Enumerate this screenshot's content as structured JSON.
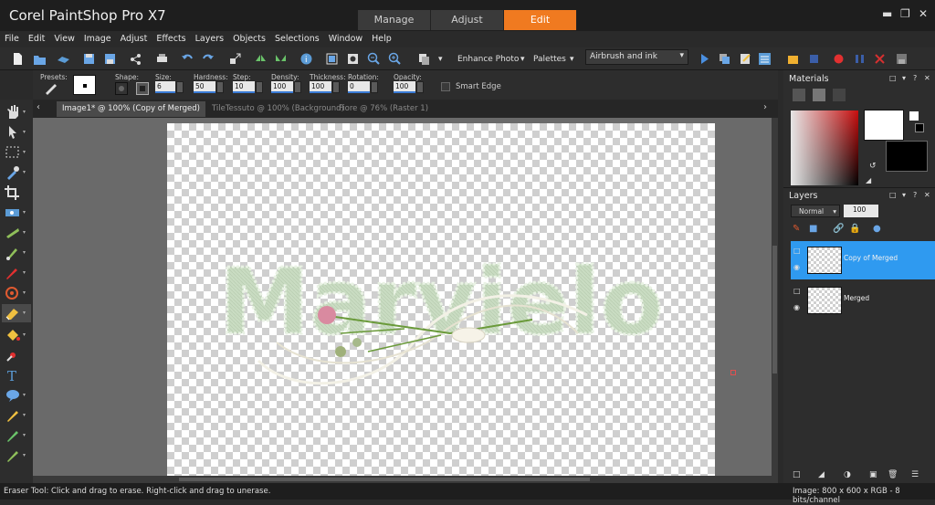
{
  "app": {
    "title": "Corel PaintShop Pro X7",
    "workspace_tabs": [
      {
        "label": "Manage",
        "active": false
      },
      {
        "label": "Adjust",
        "active": false
      },
      {
        "label": "Edit",
        "active": true
      }
    ]
  },
  "menu": [
    "File",
    "Edit",
    "View",
    "Image",
    "Adjust",
    "Effects",
    "Layers",
    "Objects",
    "Selections",
    "Window",
    "Help"
  ],
  "toolbar": {
    "enhance_photo": "Enhance Photo",
    "palettes": "Palettes",
    "workspace_select": "Airbrush and ink"
  },
  "tool_options": {
    "presets_label": "Presets:",
    "shape_label": "Shape:",
    "size_label": "Size:",
    "size_value": "6",
    "hardness_label": "Hardness:",
    "hardness_value": "50",
    "step_label": "Step:",
    "step_value": "10",
    "density_label": "Density:",
    "density_value": "100",
    "thickness_label": "Thickness:",
    "thickness_value": "100",
    "rotation_label": "Rotation:",
    "rotation_value": "0",
    "opacity_label": "Opacity:",
    "opacity_value": "100",
    "smart_edge_label": "Smart Edge"
  },
  "doc_tabs": [
    {
      "label": "Image1* @ 100% (Copy of Merged)",
      "active": true
    },
    {
      "label": "TileTessuto @ 100% (Background)",
      "active": false
    },
    {
      "label": "Fiore @  76% (Raster 1)",
      "active": false
    }
  ],
  "canvas": {
    "word": "Marvielo"
  },
  "materials": {
    "title": "Materials",
    "foreground_color": "#ffffff",
    "background_color": "#000000"
  },
  "layers": {
    "title": "Layers",
    "blend_mode": "Normal",
    "opacity": "100",
    "items": [
      {
        "name": "Copy of Merged",
        "selected": true
      },
      {
        "name": "Merged",
        "selected": false
      }
    ]
  },
  "status": {
    "hint": "Eraser Tool: Click and drag to erase. Right-click and drag to unerase.",
    "image_info": "Image:  800 x 600 x RGB - 8 bits/channel"
  },
  "colors": {
    "accent": "#f07a20",
    "selection": "#2f9af0"
  }
}
